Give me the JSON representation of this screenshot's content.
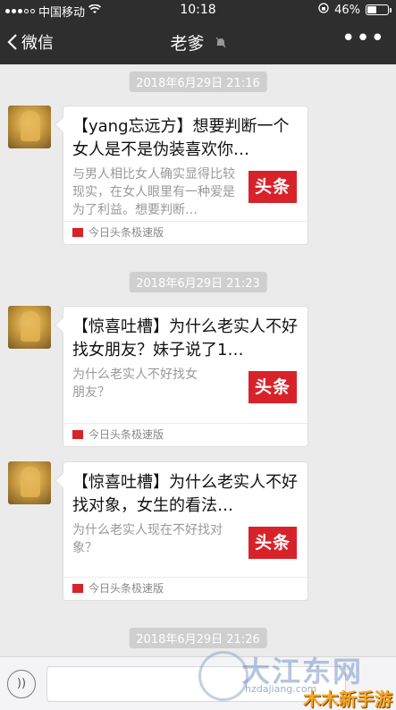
{
  "status_bar": {
    "carrier": "中国移动",
    "time": "10:18",
    "battery_percent": "46%",
    "battery_level": 0.46
  },
  "nav": {
    "back_label": "微信",
    "title": "老爹",
    "more_label": "•••"
  },
  "messages": [
    {
      "timestamp": "2018年6月29日 21:16",
      "title": "【yang忘远方】想要判断一个女人是不是伪装喜欢你…",
      "desc": "与男人相比女人确实显得比较现实，在女人眼里有一种爱是为了利益。想要判断…",
      "logo_text": "头条",
      "source": "今日头条极速版"
    },
    {
      "timestamp": "2018年6月29日 21:23",
      "title": "【惊喜吐槽】为什么老实人不好找女朋友？妹子说了1…",
      "desc": "为什么老实人不好找女朋友？",
      "logo_text": "头条",
      "source": "今日头条极速版"
    },
    {
      "timestamp": "",
      "title": "【惊喜吐槽】为什么老实人不好找对象，女生的看法…",
      "desc": "为什么老实人现在不好找对象？",
      "logo_text": "头条",
      "source": "今日头条极速版"
    }
  ],
  "last_timestamp": "2018年6月29日 21:26",
  "input_bar": {
    "voice_icon_label": "))"
  },
  "watermark": {
    "main": "大江东网",
    "url": "hzdajiang.com",
    "corner": "木木新手游"
  },
  "colors": {
    "nav_bg": "#2e2e2e",
    "chat_bg": "#ebebeb",
    "toutiao_red": "#d8222a"
  }
}
